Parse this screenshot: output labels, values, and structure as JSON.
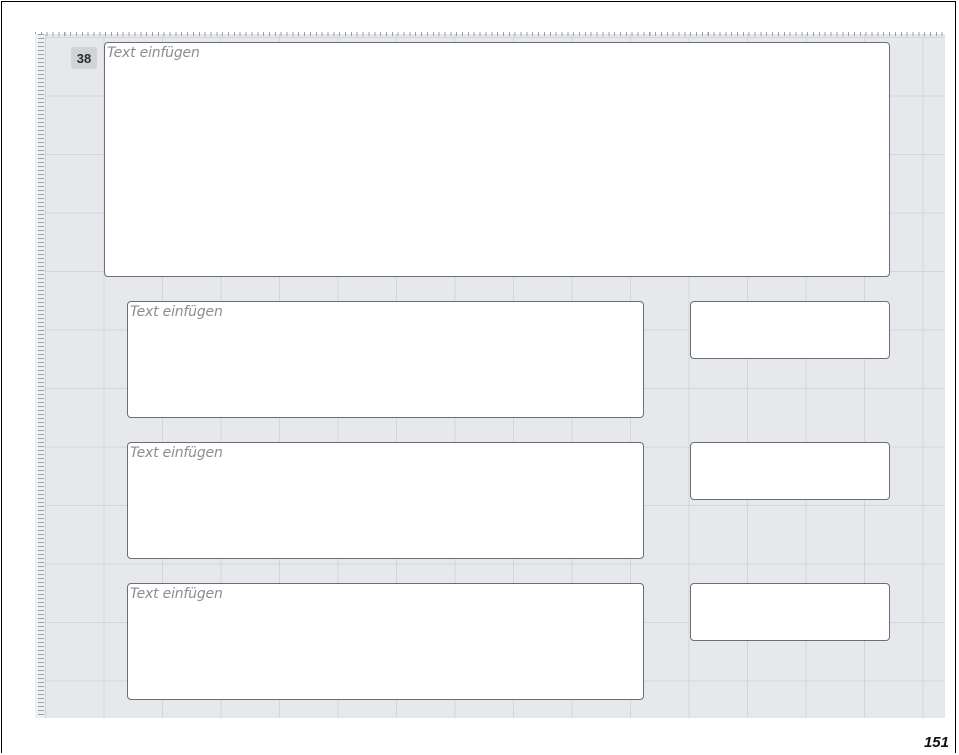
{
  "item": {
    "number": "38"
  },
  "main_box": {
    "placeholder": "Text einfügen"
  },
  "rows": [
    {
      "placeholder": "Text einfügen"
    },
    {
      "placeholder": "Text einfügen"
    },
    {
      "placeholder": "Text einfügen"
    }
  ],
  "page": {
    "number": "151"
  },
  "colors": {
    "grid_background": "#e6e8ec",
    "grid_lines": "#d2d6dc",
    "box_border": "#6b6f75"
  }
}
